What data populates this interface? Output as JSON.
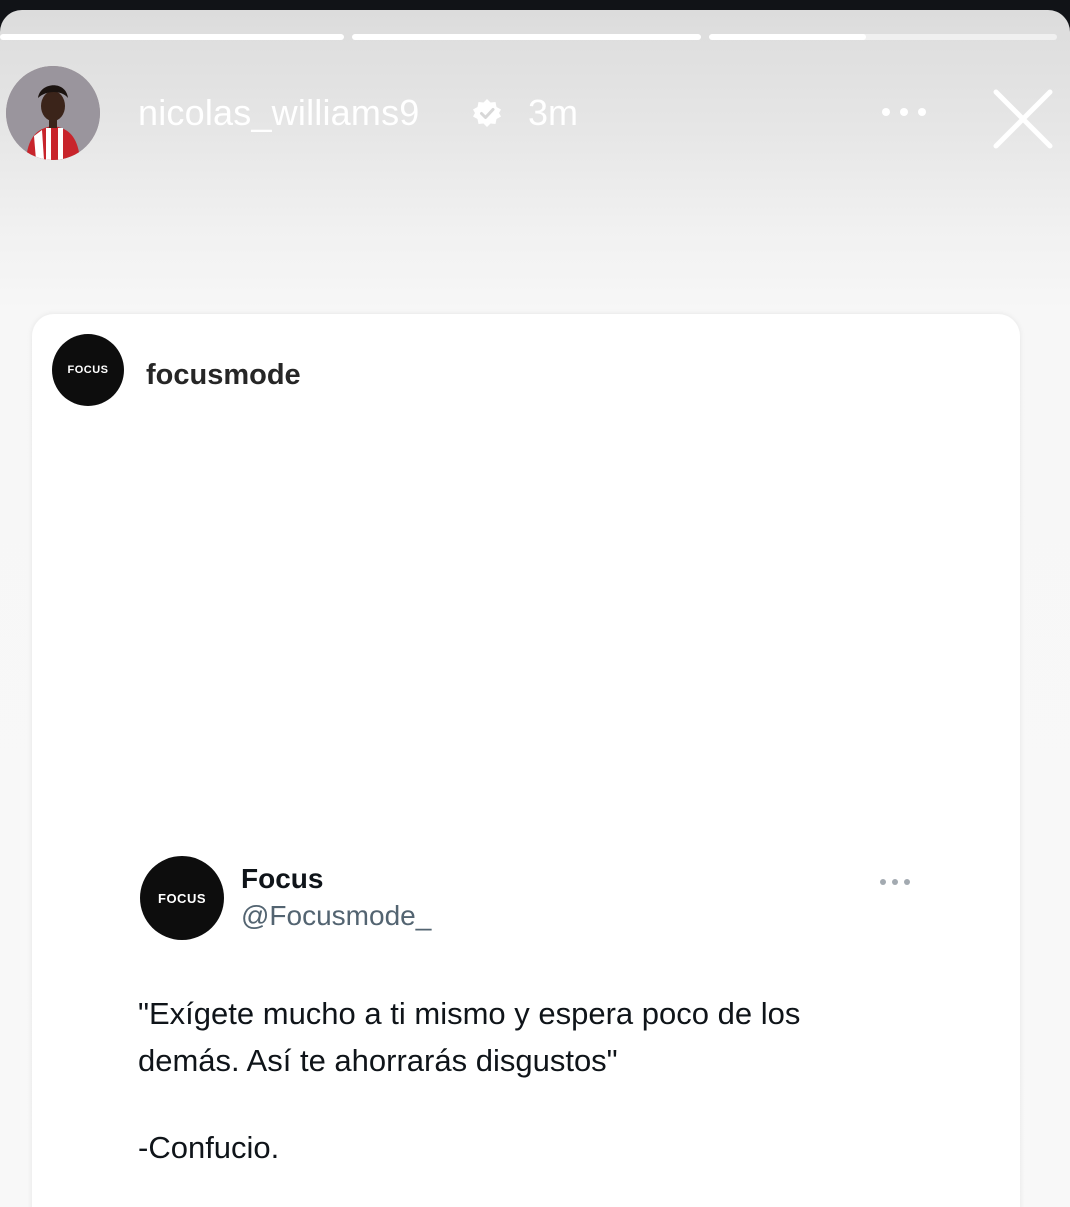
{
  "story": {
    "progress_segments": [
      {
        "filled": 1.0
      },
      {
        "filled": 1.0
      },
      {
        "filled": 0.45
      }
    ],
    "header": {
      "username": "nicolas_williams9",
      "verified": true,
      "time": "3m",
      "more_icon": "more-horizontal-icon",
      "close_icon": "close-icon"
    }
  },
  "shared_post": {
    "account_logo_text": "FOCUS",
    "account_name": "focusmode"
  },
  "tweet": {
    "logo_text": "FOCUS",
    "name": "Focus",
    "handle": "@Focusmode_",
    "more_icon": "more-horizontal-icon",
    "text": "\"Exígete mucho a ti mismo y espera poco de los\ndemás. Así te ahorrarás disgustos\"",
    "attribution": "-Confucio."
  },
  "colors": {
    "story_bg_top": "#dcdcdc",
    "story_bg_bottom": "#f8f8f8",
    "card_bg": "#ffffff",
    "logo_bg": "#0d0d0d",
    "handle_color": "#536471"
  }
}
